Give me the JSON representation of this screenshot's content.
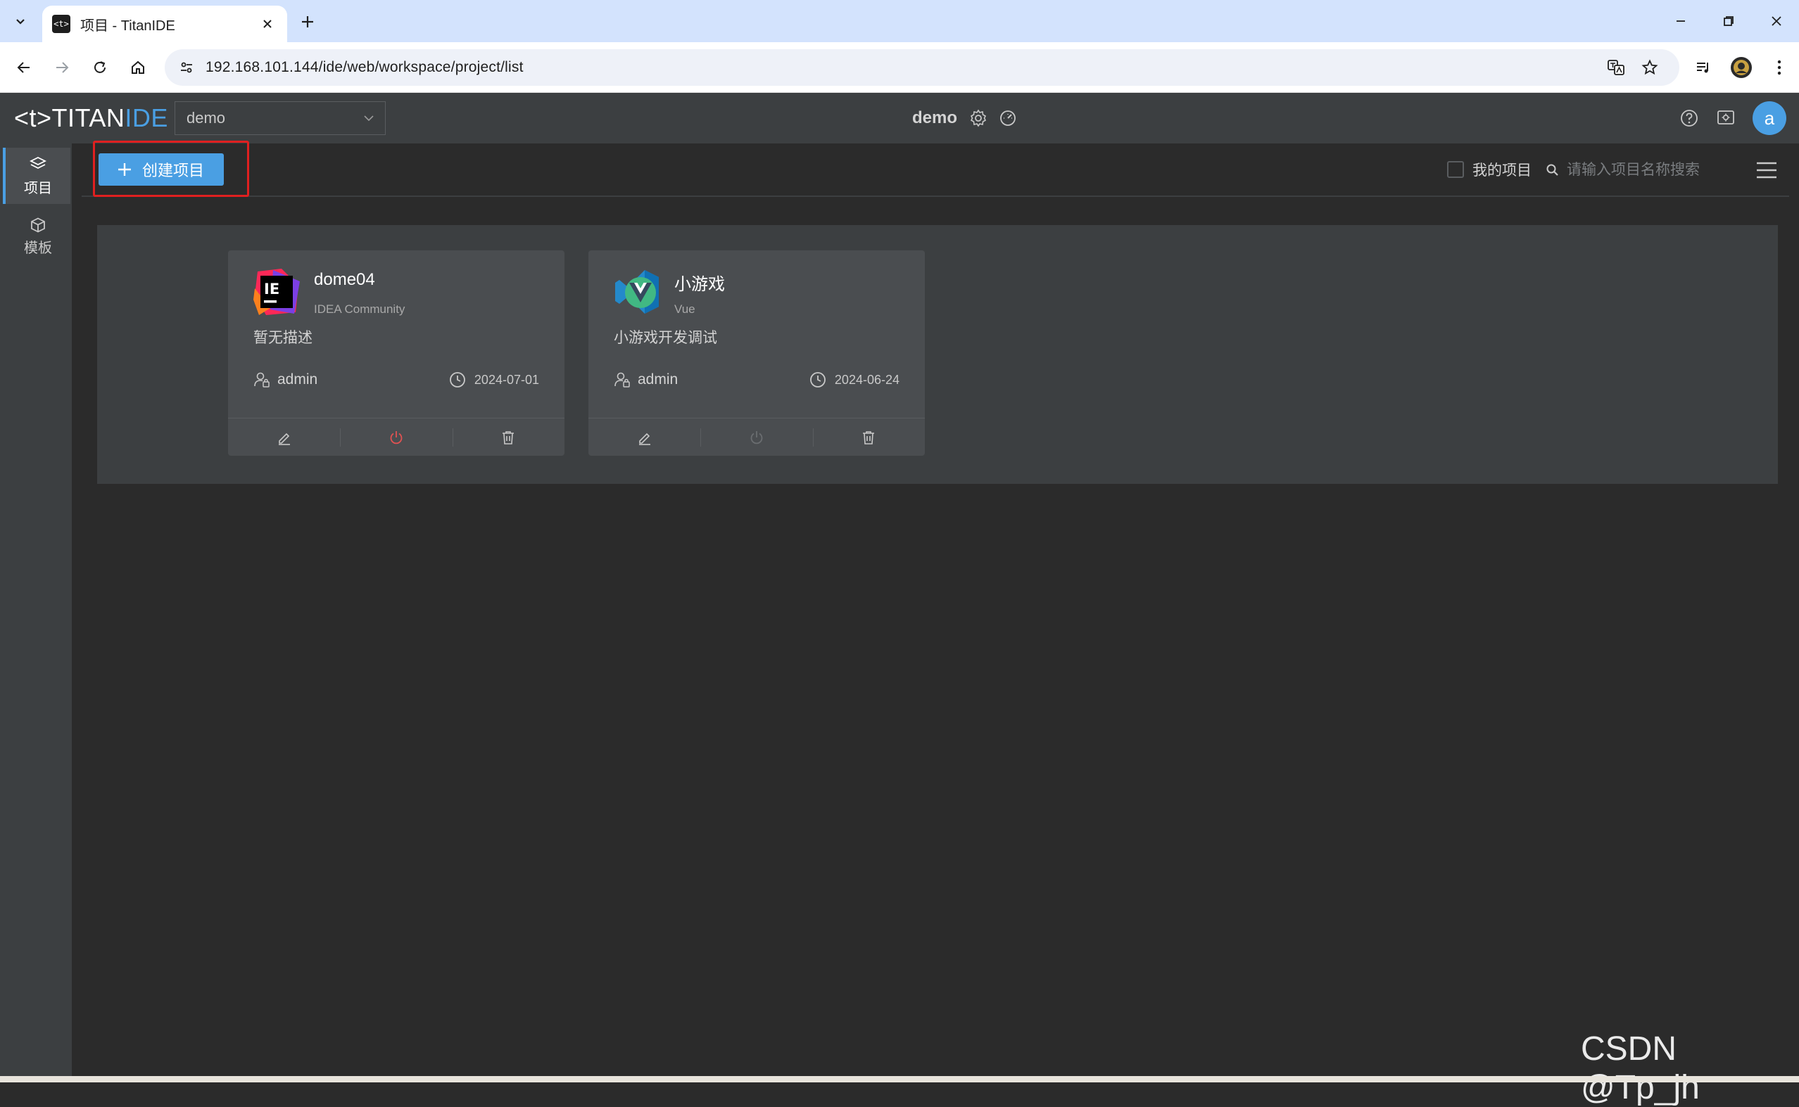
{
  "browser": {
    "tab_title": "项目 - TitanIDE",
    "tab_favicon_text": "<t>",
    "url": "192.168.101.144/ide/web/workspace/project/list"
  },
  "app": {
    "logo_part1": "<t>TITAN",
    "logo_part2": "IDE",
    "workspace_select": "demo",
    "workspace_title": "demo",
    "avatar_letter": "a",
    "accent_color": "#4a9fe3"
  },
  "rail": {
    "items": [
      {
        "label": "项目",
        "icon": "layers-icon",
        "active": true
      },
      {
        "label": "模板",
        "icon": "cube-icon",
        "active": false
      }
    ]
  },
  "toolbar": {
    "create_label": "创建项目",
    "my_projects_label": "我的项目",
    "search_placeholder": "请输入项目名称搜索"
  },
  "projects": [
    {
      "name": "dome04",
      "type": "IDEA Community",
      "description": "暂无描述",
      "owner": "admin",
      "date": "2024-07-01",
      "icon": "intellij-idea-icon",
      "power_color": "#e05252"
    },
    {
      "name": "小游戏",
      "type": "Vue",
      "description": "小游戏开发调试",
      "owner": "admin",
      "date": "2024-06-24",
      "icon": "vue-vscode-icon",
      "power_color": "#6a6d70"
    }
  ],
  "watermark": "CSDN @Tp_jh"
}
